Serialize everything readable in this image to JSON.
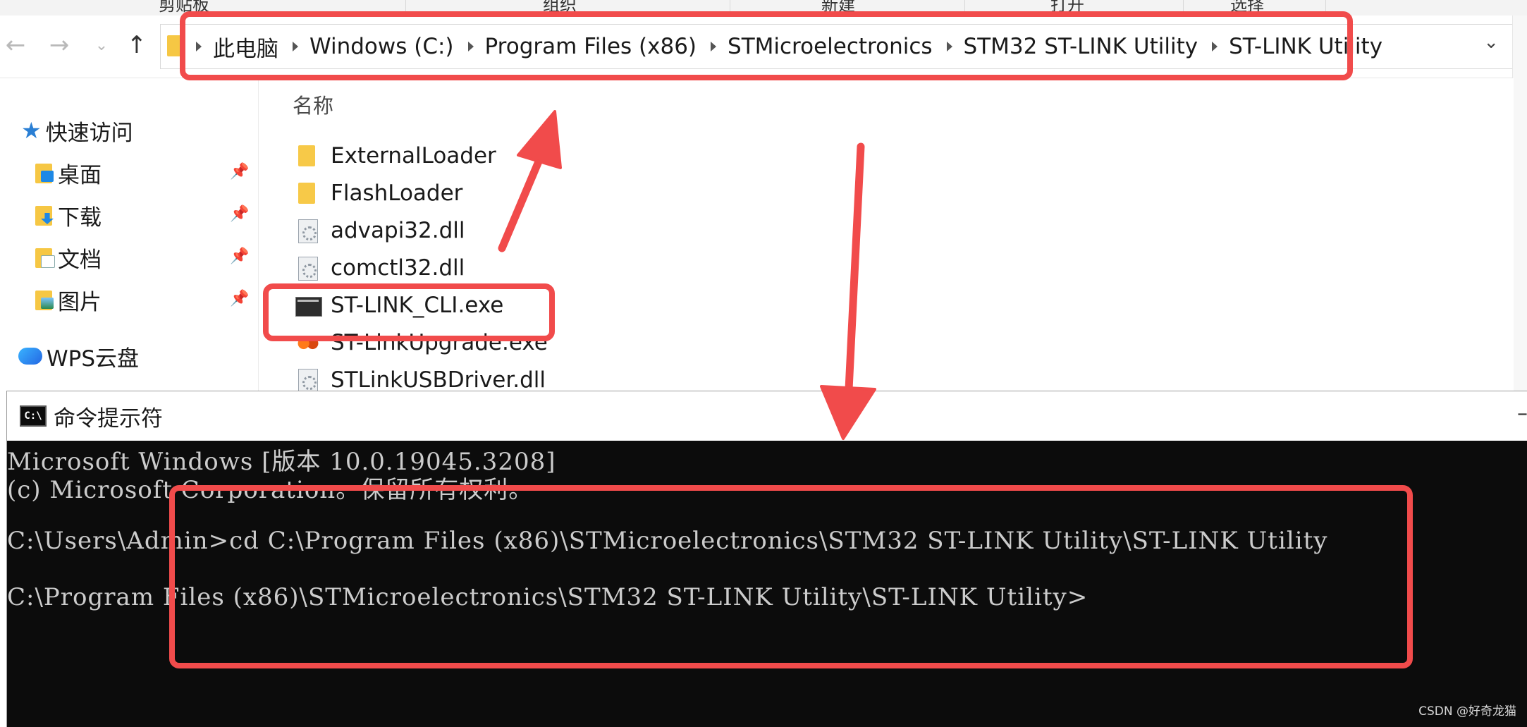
{
  "explorer": {
    "ribbon_groups": [
      "剪贴板",
      "组织",
      "新建",
      "打开",
      "选择"
    ],
    "address_crumbs": [
      "此电脑",
      "Windows (C:)",
      "Program Files (x86)",
      "STMicroelectronics",
      "STM32 ST-LINK Utility",
      "ST-LINK Utility"
    ],
    "sidebar": {
      "quick_access": "快速访问",
      "items": [
        "桌面",
        "下载",
        "文档",
        "图片"
      ],
      "wps": "WPS云盘"
    },
    "column_header": "名称",
    "files": [
      {
        "name": "ExternalLoader",
        "type": "folder"
      },
      {
        "name": "FlashLoader",
        "type": "folder"
      },
      {
        "name": "advapi32.dll",
        "type": "dll"
      },
      {
        "name": "comctl32.dll",
        "type": "dll"
      },
      {
        "name": "ST-LINK_CLI.exe",
        "type": "exe-cli"
      },
      {
        "name": "ST-LinkUpgrade.exe",
        "type": "exe-upgrade"
      },
      {
        "name": "STLinkUSBDriver.dll",
        "type": "dll"
      }
    ]
  },
  "cmd": {
    "title": "命令提示符",
    "icon_text": "C:\\",
    "lines": [
      "Microsoft Windows [版本 10.0.19045.3208]",
      "(c) Microsoft Corporation。保留所有权利。",
      "",
      "C:\\Users\\Admin>cd C:\\Program Files (x86)\\STMicroelectronics\\STM32 ST-LINK Utility\\ST-LINK Utility",
      "",
      "C:\\Program Files (x86)\\STMicroelectronics\\STM32 ST-LINK Utility\\ST-LINK Utility>"
    ]
  },
  "watermark": "CSDN @好奇龙猫",
  "colors": {
    "annotation_red": "#f14b4b",
    "console_bg": "#0c0c0c",
    "console_text": "#cccccc",
    "folder_yellow": "#f6c744"
  }
}
